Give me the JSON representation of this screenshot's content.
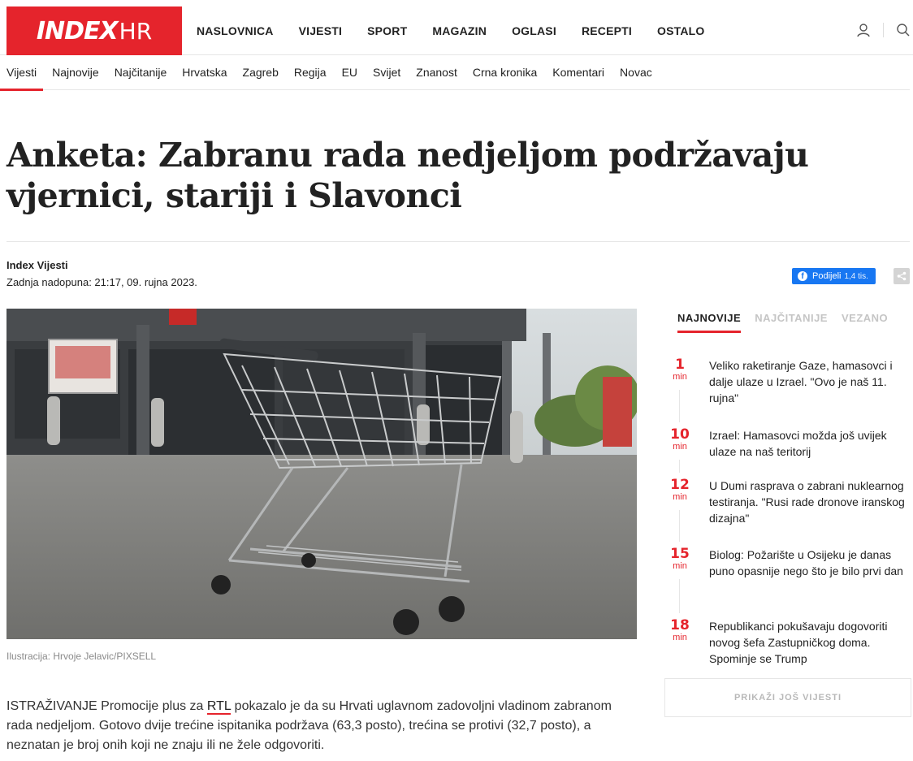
{
  "brand": {
    "logo_main": "INDEX",
    "logo_suffix": "HR",
    "accent": "#e5242c"
  },
  "main_nav": [
    {
      "label": "NASLOVNICA"
    },
    {
      "label": "VIJESTI"
    },
    {
      "label": "SPORT"
    },
    {
      "label": "MAGAZIN"
    },
    {
      "label": "OGLASI"
    },
    {
      "label": "RECEPTI"
    },
    {
      "label": "OSTALO"
    }
  ],
  "header_icons": {
    "user": "user-icon",
    "search": "search-icon"
  },
  "sub_nav": [
    {
      "label": "Vijesti",
      "active": true
    },
    {
      "label": "Najnovije"
    },
    {
      "label": "Najčitanije"
    },
    {
      "label": "Hrvatska"
    },
    {
      "label": "Zagreb"
    },
    {
      "label": "Regija"
    },
    {
      "label": "EU"
    },
    {
      "label": "Svijet"
    },
    {
      "label": "Znanost"
    },
    {
      "label": "Crna kronika"
    },
    {
      "label": "Komentari"
    },
    {
      "label": "Novac"
    }
  ],
  "article": {
    "title": "Anketa: Zabranu rada nedjeljom podržavaju vjernici, stariji i Slavonci",
    "author": "Index Vijesti",
    "updated": "Zadnja nadopuna: 21:17, 09. rujna 2023.",
    "share_label": "Podijeli",
    "share_count": "1,4 tis.",
    "caption": "Ilustracija: Hrvoje Jelavic/PIXSELL",
    "lead_1": "ISTRAŽIVANJE Promocije plus za ",
    "lead_link": "RTL",
    "lead_2": " pokazalo je da su Hrvati uglavnom zadovoljni vladinom zabranom rada nedjeljom. Gotovo dvije trećine ispitanika podržava (63,3 posto), trećina se protivi (32,7 posto), a neznatan je broj onih koji ne znaju ili ne žele odgovoriti."
  },
  "sidebar": {
    "tabs": [
      {
        "label": "NAJNOVIJE",
        "active": true
      },
      {
        "label": "NAJČITANIJE"
      },
      {
        "label": "VEZANO"
      }
    ],
    "news": [
      {
        "time": "1",
        "unit": "min",
        "title": "Veliko raketiranje Gaze, hamasovci i dalje ulaze u Izrael. \"Ovo je naš 11. rujna\""
      },
      {
        "time": "10",
        "unit": "min",
        "title": "Izrael: Hamasovci možda još uvijek ulaze na naš teritorij"
      },
      {
        "time": "12",
        "unit": "min",
        "title": "U Dumi rasprava o zabrani nuklearnog testiranja. \"Rusi rade dronove iranskog dizajna\""
      },
      {
        "time": "15",
        "unit": "min",
        "title": "Biolog: Požarište u Osijeku je danas puno opasnije nego što je bilo prvi dan"
      },
      {
        "time": "18",
        "unit": "min",
        "title": "Republikanci pokušavaju dogovoriti novog šefa Zastupničkog doma. Spominje se Trump"
      }
    ],
    "more_label": "PRIKAŽI JOŠ VIJESTI"
  }
}
